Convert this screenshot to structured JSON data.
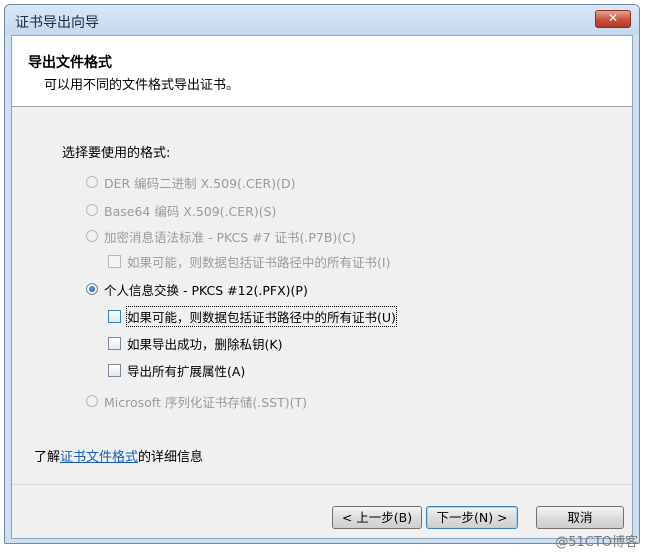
{
  "window": {
    "title": "证书导出向导",
    "close_glyph": "✕"
  },
  "header": {
    "title": "导出文件格式",
    "subtitle": "可以用不同的文件格式导出证书。"
  },
  "formats": {
    "label": "选择要使用的格式:",
    "options": [
      {
        "label": "DER 编码二进制 X.509(.CER)(D)",
        "selected": false,
        "enabled": false
      },
      {
        "label": "Base64 编码 X.509(.CER)(S)",
        "selected": false,
        "enabled": false
      },
      {
        "label": "加密消息语法标准 - PKCS #7 证书(.P7B)(C)",
        "selected": false,
        "enabled": false
      },
      {
        "label": "个人信息交换 - PKCS #12(.PFX)(P)",
        "selected": true,
        "enabled": true
      },
      {
        "label": "Microsoft 序列化证书存储(.SST)(T)",
        "selected": false,
        "enabled": false
      }
    ],
    "p7b_include_chain": {
      "label": "如果可能，则数据包括证书路径中的所有证书(I)",
      "checked": false,
      "enabled": false
    },
    "pfx_options": [
      {
        "label": "如果可能，则数据包括证书路径中的所有证书(U)",
        "checked": false,
        "enabled": true
      },
      {
        "label": "如果导出成功，删除私钥(K)",
        "checked": false,
        "enabled": true
      },
      {
        "label": "导出所有扩展属性(A)",
        "checked": false,
        "enabled": true
      }
    ]
  },
  "learn_more": {
    "prefix": "了解",
    "link": "证书文件格式",
    "suffix": "的详细信息"
  },
  "buttons": {
    "back": "< 上一步(B)",
    "next": "下一步(N) >",
    "cancel": "取消"
  },
  "watermark": "@51CTO博客"
}
